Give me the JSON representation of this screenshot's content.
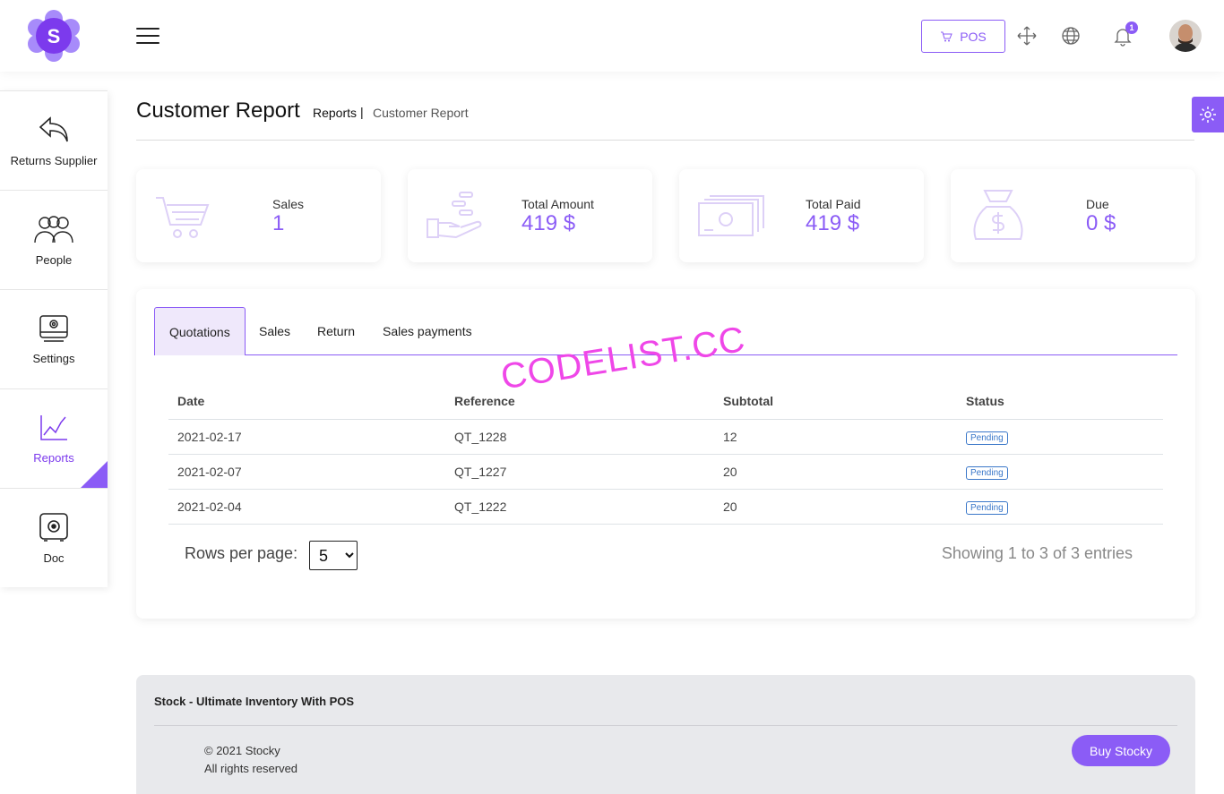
{
  "header": {
    "pos_label": "POS",
    "notification_count": "1",
    "icons": [
      "cart-icon",
      "fullscreen-icon",
      "globe-icon",
      "bell-icon"
    ]
  },
  "sidebar": {
    "items": [
      {
        "label": "Returns Supplier",
        "icon": "return-arrow-icon"
      },
      {
        "label": "People",
        "icon": "people-icon"
      },
      {
        "label": "Settings",
        "icon": "settings-drive-icon"
      },
      {
        "label": "Reports",
        "icon": "line-chart-icon",
        "active": true
      },
      {
        "label": "Doc",
        "icon": "document-icon"
      }
    ]
  },
  "breadcrumb": {
    "title": "Customer Report",
    "parent": "Reports",
    "separator": "|",
    "current": "Customer Report"
  },
  "stats": [
    {
      "title": "Sales",
      "value": "1",
      "icon": "cart-icon"
    },
    {
      "title": "Total Amount",
      "value": "419 $",
      "icon": "hand-coins-icon"
    },
    {
      "title": "Total Paid",
      "value": "419 $",
      "icon": "money-stack-icon"
    },
    {
      "title": "Due",
      "value": "0 $",
      "icon": "money-bag-icon"
    }
  ],
  "tabs": [
    {
      "label": "Quotations",
      "active": true
    },
    {
      "label": "Sales"
    },
    {
      "label": "Return"
    },
    {
      "label": "Sales payments"
    }
  ],
  "table": {
    "columns": [
      "Date",
      "Reference",
      "Subtotal",
      "Status"
    ],
    "rows": [
      {
        "date": "2021-02-17",
        "reference": "QT_1228",
        "subtotal": "12",
        "status": "Pending"
      },
      {
        "date": "2021-02-07",
        "reference": "QT_1227",
        "subtotal": "20",
        "status": "Pending"
      },
      {
        "date": "2021-02-04",
        "reference": "QT_1222",
        "subtotal": "20",
        "status": "Pending"
      }
    ]
  },
  "pagination": {
    "rows_label": "Rows per page:",
    "rows_value": "5",
    "showing": "Showing 1 to 3 of 3 entries"
  },
  "watermark": "CODELIST.CC",
  "footer": {
    "title": "Stock - Ultimate Inventory With POS",
    "copyright": "© 2021 Stocky",
    "rights": "All rights reserved",
    "buy_label": "Buy Stocky"
  },
  "colors": {
    "accent": "#8b5cf6",
    "status": "#3a77c9",
    "watermark": "#ef47e8"
  }
}
